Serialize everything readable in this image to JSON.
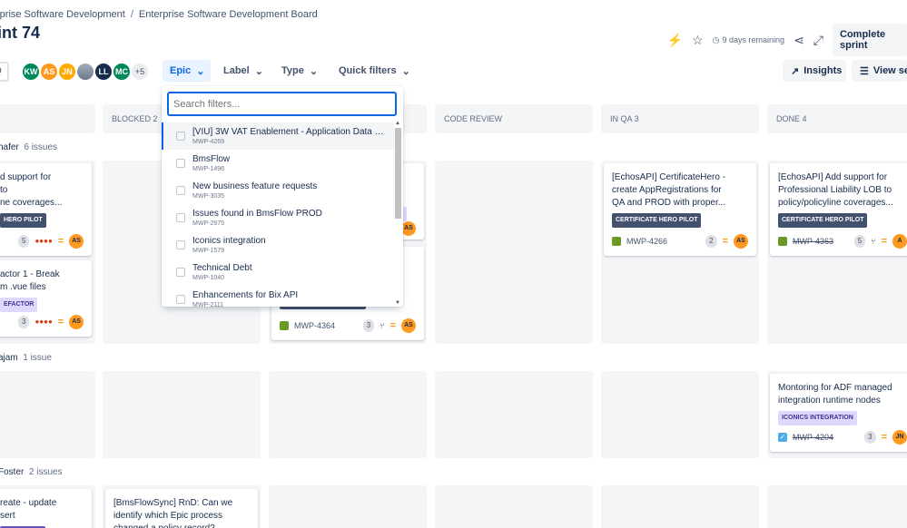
{
  "breadcrumb": {
    "part1": "rprise Software Development",
    "sep": "/",
    "part2": "Enterprise Software Development Board"
  },
  "title": "int 74",
  "header": {
    "days_remaining": "9 days remaining",
    "complete_label": "Complete sprint"
  },
  "toolbar": {
    "search_glyph": "Q",
    "avatars": [
      {
        "initials": "KW",
        "color": "#00875a"
      },
      {
        "initials": "AS",
        "color": "#ff991f"
      },
      {
        "initials": "JN",
        "color": "#ffab00"
      },
      {
        "initials": "",
        "color": "#8993a4"
      },
      {
        "initials": "LL",
        "color": "#172b4d"
      },
      {
        "initials": "MC",
        "color": "#00875a"
      }
    ],
    "more_label": "+5",
    "filters": {
      "epic": "Epic",
      "label": "Label",
      "type": "Type",
      "quick": "Quick filters"
    },
    "insights_label": "Insights",
    "view_label": "View set"
  },
  "columns": {
    "blocked": "BLOCKED 2",
    "code_review": "CODE REVIEW",
    "in_qa": "IN QA 3",
    "done": "DONE 4"
  },
  "lanes": {
    "lane1": {
      "name": "hafer",
      "count": "6 issues"
    },
    "lane2": {
      "name": "ajam",
      "count": "1 issue"
    },
    "lane3": {
      "name": "Foster",
      "count": "2 issues"
    }
  },
  "cards": {
    "c1": {
      "title": "d support for\nto\nne coverages...",
      "tag": "HERO PILOT",
      "est": "5",
      "assignee": "AS"
    },
    "c2": {
      "title": "actor 1 - Break\nm .vue files",
      "tag": "EFACTOR",
      "est": "3",
      "assignee": "AS"
    },
    "c3": {
      "key": "MWP-4364",
      "est": "3",
      "assignee": "AS"
    },
    "c3b": {
      "tag": "A...",
      "assignee": "AS"
    },
    "c4": {
      "title": "[EchosAPI] CertificateHero -\ncreate AppRegistrations for\nQA and PROD with proper...",
      "tag": "CERTIFICATE HERO PILOT",
      "key": "MWP-4266",
      "est": "2",
      "assignee": "AS"
    },
    "c5": {
      "title": "[EchosAPI] Add support for\nProfessional Liability LOB to\npolicy/policyline coverages...",
      "tag": "CERTIFICATE HERO PILOT",
      "key": "MWP-4363",
      "est": "5",
      "assignee": "A"
    },
    "c6": {
      "title": "Montoring for ADF managed\nintegration runtime nodes",
      "tag": "ICONICS INTEGRATION",
      "key": "MWP-4204",
      "est": "3",
      "assignee": "JN"
    },
    "c7": {
      "title": "reate - update\nsert"
    },
    "c8": {
      "title": "[BmsFlowSync] RnD: Can we\nidentify which Epic process\nchanged a policy record?"
    }
  },
  "dropdown": {
    "placeholder": "Search filters...",
    "items": [
      {
        "name": "[VIU] 3W VAT Enablement - Application Data Por...",
        "key": "MWP-4269"
      },
      {
        "name": "BmsFlow",
        "key": "MWP-1496"
      },
      {
        "name": "New business feature requests",
        "key": "MWP-3035"
      },
      {
        "name": "Issues found in BmsFlow PROD",
        "key": "MWP-2975"
      },
      {
        "name": "Iconics integration",
        "key": "MWP-1579"
      },
      {
        "name": "Technical Debt",
        "key": "MWP-1040"
      },
      {
        "name": "Enhancements for Bix API",
        "key": "MWP-2111"
      }
    ]
  }
}
